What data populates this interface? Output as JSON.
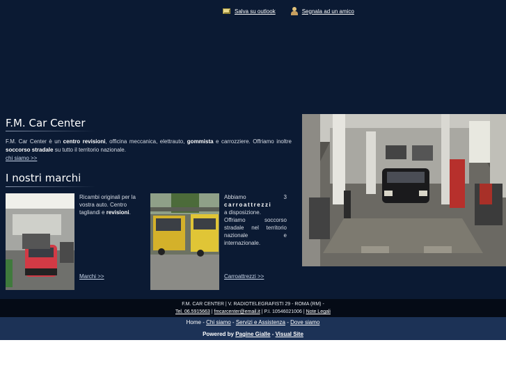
{
  "header": {
    "save_outlook": "Salva su outlook",
    "tell_friend": "Segnala ad un amico",
    "save_icon": "envelope-icon",
    "friend_icon": "person-icon"
  },
  "intro": {
    "title": "F.M. Car Center",
    "p1": "F.M. Car Center è un ",
    "b1": "centro revisioni",
    "p2": ", officina meccanica, elettrauto, ",
    "b2": "gommista",
    "p3": " e carrozziere. Offriamo inoltre ",
    "b3": "soccorso stradale",
    "p4": " su tutto il territorio nazionale.",
    "link": "chi siamo >>"
  },
  "brands": {
    "title": "I nostri marchi",
    "card1": {
      "t1": "Ricambi originali per la vostra auto. Centro tagliandi e ",
      "b1": "revisioni",
      "t2": ".",
      "link": "Marchi >>"
    },
    "card2": {
      "t1": "Abbiamo 3",
      "b1": "carroattrezzi",
      "t2": "a disposizione.",
      "t3": "Offriamo soccorso stradale nel territorio nazionale e internazionale.",
      "link": "Carroattrezzi >>"
    }
  },
  "footer": {
    "address": "F.M. CAR CENTER | V. RADIOTELEGRAFISTI 29 - ROMA (RM) -",
    "phone": "Tel. 06.5915663",
    "email": "fmcarcenter@email.it",
    "piva": "P.I. 10546021006",
    "legal": "Note Legali",
    "nav": {
      "home": "Home",
      "chi_siamo": "Chi siamo",
      "servizi": "Servizi e Assistenza",
      "dove": "Dove siamo",
      "dash": "-"
    },
    "powered_by": "Powered by",
    "pagine_gialle": "Pagine Gialle",
    "visual_site": "Visual Site"
  },
  "colors": {
    "background": "#0b1a33",
    "footer_dark": "#050b16",
    "nav_bar": "#1c3256",
    "text": "#d8dde6"
  }
}
